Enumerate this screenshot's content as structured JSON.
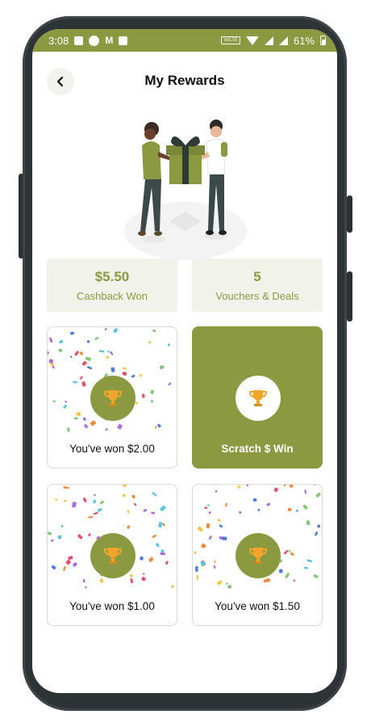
{
  "status_bar": {
    "time": "3:08",
    "battery": "61%",
    "network_label": "VoLTE"
  },
  "header": {
    "title": "My Rewards",
    "back_icon": "chevron-left-icon"
  },
  "stats": [
    {
      "value": "$5.50",
      "label": "Cashback Won"
    },
    {
      "value": "5",
      "label": "Vouchers & Deals"
    }
  ],
  "rewards": [
    {
      "label": "You've won $2.00",
      "state": "won",
      "icon": "trophy-icon"
    },
    {
      "label": "Scratch $ Win",
      "state": "scratch",
      "icon": "trophy-icon"
    },
    {
      "label": "You've won $1.00",
      "state": "won",
      "icon": "trophy-icon"
    },
    {
      "label": "You've won $1.50",
      "state": "won",
      "icon": "trophy-icon"
    }
  ],
  "colors": {
    "accent": "#8b9a41",
    "stat_background": "#f1f2ea",
    "trophy": "#f2a52b"
  }
}
